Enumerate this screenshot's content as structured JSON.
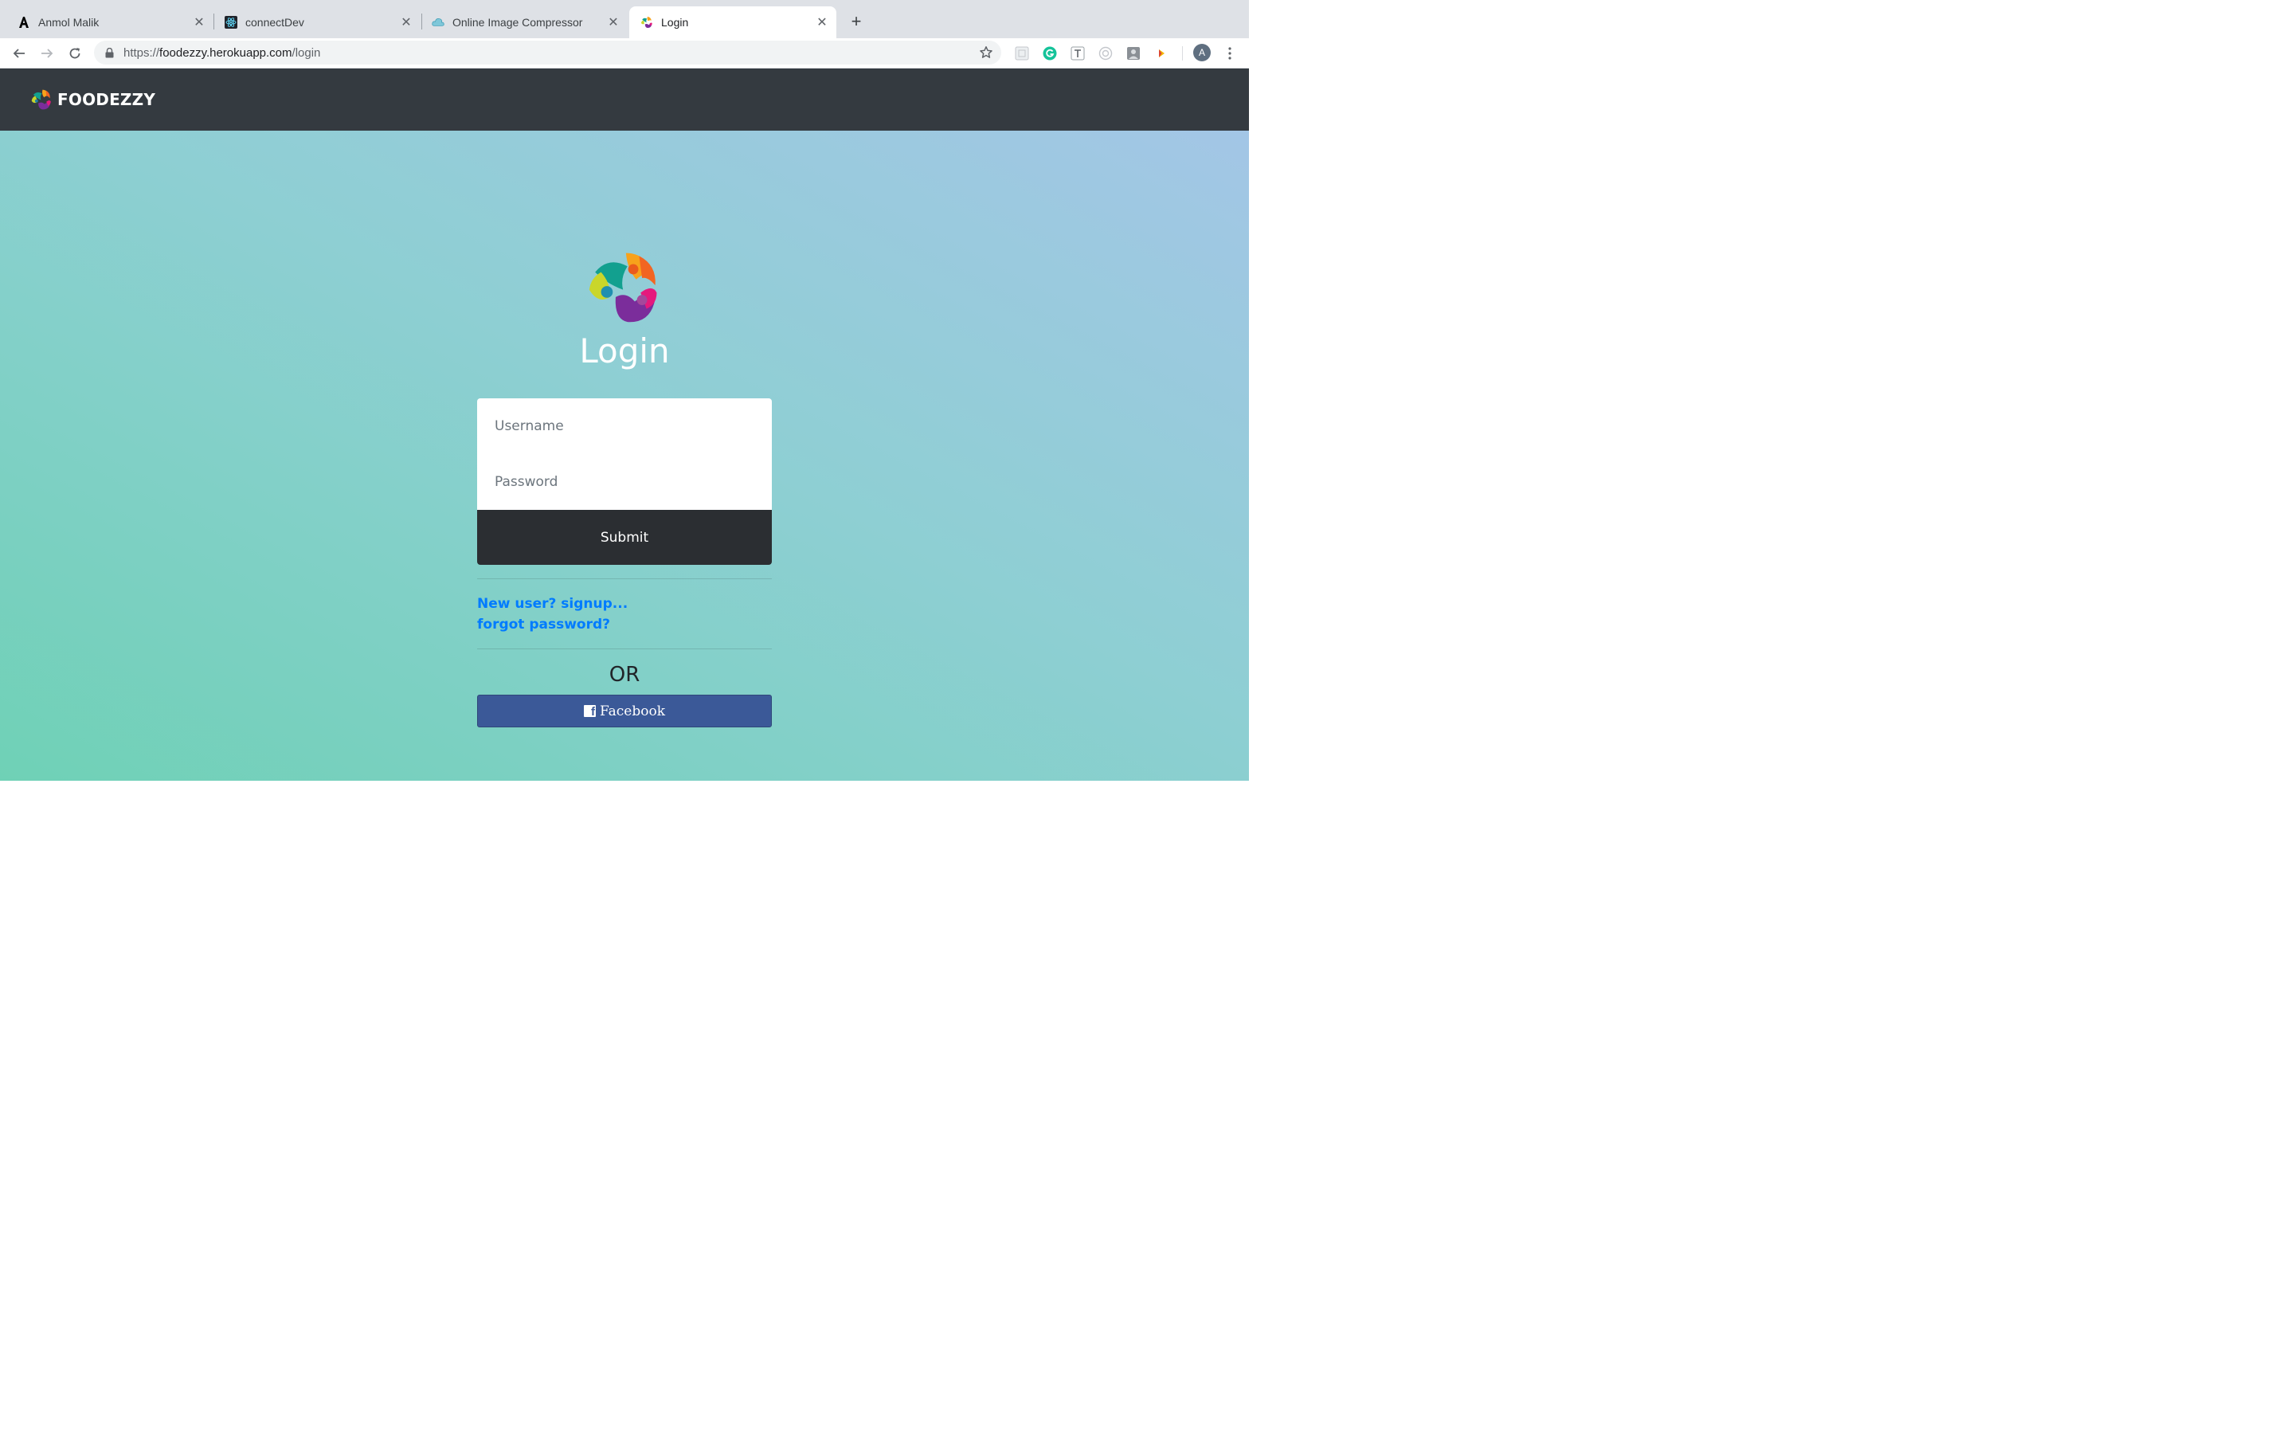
{
  "browser": {
    "tabs": [
      {
        "title": "Anmol Malik",
        "favicon": "letter-a-icon",
        "active": false
      },
      {
        "title": "connectDev",
        "favicon": "react-atom-icon",
        "active": false
      },
      {
        "title": "Online Image Compressor",
        "favicon": "cloud-icon",
        "active": false
      },
      {
        "title": "Login",
        "favicon": "foodezzy-logo-icon",
        "active": true
      }
    ],
    "address": {
      "scheme": "https://",
      "host": "foodezzy.herokuapp.com",
      "path": "/login"
    },
    "profile_initial": "A"
  },
  "site": {
    "brand": "FOODEZZY"
  },
  "login": {
    "title": "Login",
    "username_placeholder": "Username",
    "password_placeholder": "Password",
    "submit_label": "Submit",
    "signup_link": "New user? signup...",
    "forgot_link": "forgot password?",
    "or_text": "OR",
    "facebook_label": "Facebook",
    "facebook_icon_glyph": "f"
  },
  "colors": {
    "navbar": "#343a40",
    "submit": "#2b2e32",
    "link": "#007bff",
    "facebook": "#3b5998"
  }
}
